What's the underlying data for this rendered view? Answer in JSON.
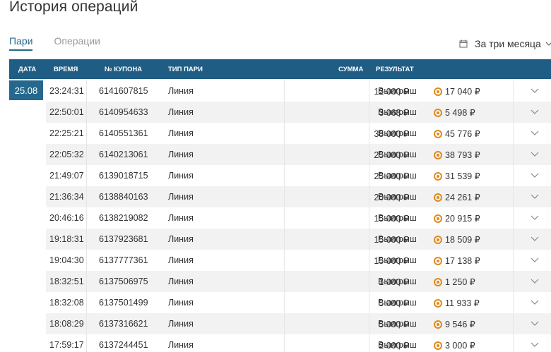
{
  "page": {
    "title": "История операций"
  },
  "tabs": [
    {
      "label": "Пари",
      "active": true
    },
    {
      "label": "Операции",
      "active": false
    }
  ],
  "period": {
    "label": "За три месяца"
  },
  "table": {
    "headers": {
      "date": "ДАТА",
      "time": "ВРЕМЯ",
      "coupon": "№ КУПОНА",
      "type": "ТИП ПАРИ",
      "sum": "СУММА",
      "result": "РЕЗУЛЬТАТ"
    },
    "date": "25.08",
    "rows": [
      {
        "time": "23:24:31",
        "coupon": "6141607815",
        "type": "Линия",
        "sum": "12 000 ₽",
        "result": "Выигрыш",
        "win": "17 040 ₽"
      },
      {
        "time": "22:50:01",
        "coupon": "6140954633",
        "type": "Линия",
        "sum": "3 068 ₽",
        "result": "Выигрыш",
        "win": "5 498 ₽"
      },
      {
        "time": "22:25:21",
        "coupon": "6140551361",
        "type": "Линия",
        "sum": "38 000 ₽",
        "result": "Выигрыш",
        "win": "45 776 ₽"
      },
      {
        "time": "22:05:32",
        "coupon": "6140213061",
        "type": "Линия",
        "sum": "25 000 ₽",
        "result": "Выигрыш",
        "win": "38 793 ₽"
      },
      {
        "time": "21:49:07",
        "coupon": "6139018715",
        "type": "Линия",
        "sum": "25 000 ₽",
        "result": "Выигрыш",
        "win": "31 539 ₽"
      },
      {
        "time": "21:36:34",
        "coupon": "6138840163",
        "type": "Линия",
        "sum": "20 000 ₽",
        "result": "Выигрыш",
        "win": "24 261 ₽"
      },
      {
        "time": "20:46:16",
        "coupon": "6138219082",
        "type": "Линия",
        "sum": "15 000 ₽",
        "result": "Выигрыш",
        "win": "20 915 ₽"
      },
      {
        "time": "19:18:31",
        "coupon": "6137923681",
        "type": "Линия",
        "sum": "15 000 ₽",
        "result": "Выигрыш",
        "win": "18 509 ₽"
      },
      {
        "time": "19:04:30",
        "coupon": "6137777361",
        "type": "Линия",
        "sum": "15 000 ₽",
        "result": "Выигрыш",
        "win": "17 138 ₽"
      },
      {
        "time": "18:32:51",
        "coupon": "6137506975",
        "type": "Линия",
        "sum": "1 000 ₽",
        "result": "Выигрыш",
        "win": "1 250 ₽"
      },
      {
        "time": "18:32:08",
        "coupon": "6137501499",
        "type": "Линия",
        "sum": "5 000 ₽",
        "result": "Выигрыш",
        "win": "11 933 ₽"
      },
      {
        "time": "18:08:29",
        "coupon": "6137316621",
        "type": "Линия",
        "sum": "5 000 ₽",
        "result": "Выигрыш",
        "win": "9 546 ₽"
      },
      {
        "time": "17:59:17",
        "coupon": "6137244451",
        "type": "Линия",
        "sum": "2 000 ₽",
        "result": "Выигрыш",
        "win": "3 000 ₽"
      }
    ]
  },
  "icons": {
    "calendar": "calendar-icon",
    "chevron": "chevron-down-icon",
    "coin": "coin-icon"
  },
  "colors": {
    "header_bg": "#1f5d84",
    "accent": "#26688d",
    "coin": "#e08a1e"
  }
}
